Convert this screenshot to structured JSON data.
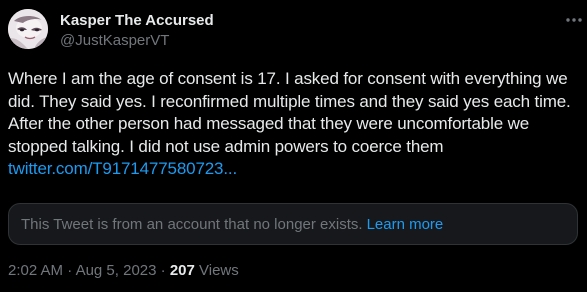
{
  "author": {
    "display_name": "Kasper The Accursed",
    "handle": "@JustKasperVT",
    "avatar_icon": "avatar-image"
  },
  "menu_icon": "more-options-icon",
  "tweet": {
    "text": "Where I am the age of consent is 17. I asked for consent with everything we did. They said yes. I reconfirmed multiple times and they said yes each time. After the other person had messaged that they were uncomfortable we stopped talking. I did not use admin powers to coerce them ",
    "link": "twitter.com/T9171477580723..."
  },
  "quoted_notice": {
    "text": "This Tweet is from an account that no longer exists.",
    "learn_more": "Learn more"
  },
  "meta": {
    "time": "2:02 AM",
    "separator1": " · ",
    "date": "Aug 5, 2023",
    "separator2": " · ",
    "views_count": "207",
    "views_label": " Views"
  },
  "colors": {
    "background": "#000000",
    "text_primary": "#e7e9ea",
    "text_secondary": "#71767b",
    "link": "#1d9bf0",
    "notice_bg": "#16181c",
    "notice_border": "#2f3336"
  }
}
